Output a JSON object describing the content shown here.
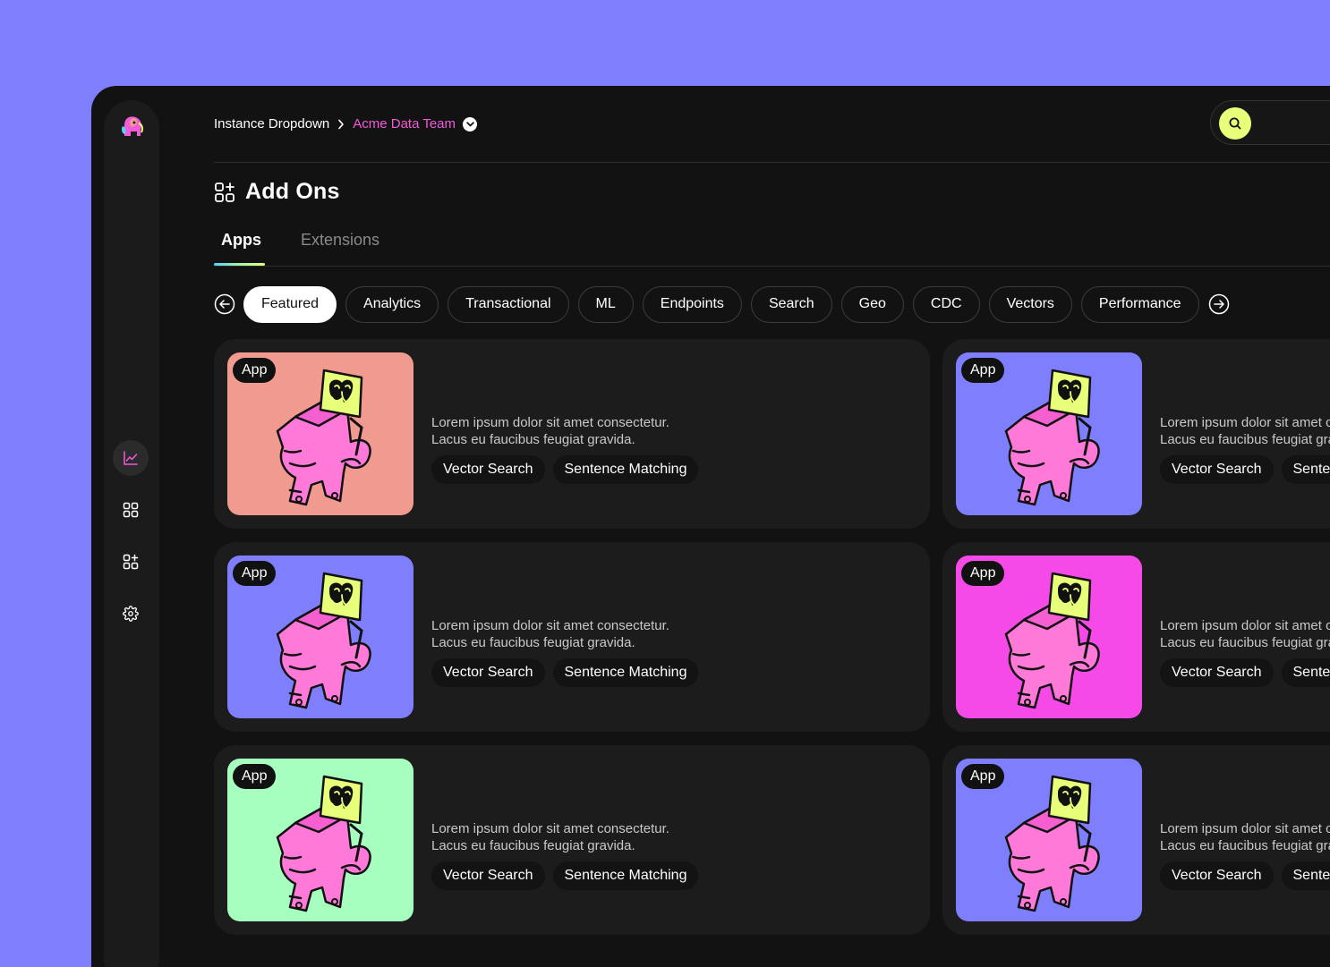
{
  "breadcrumb": {
    "instance": "Instance Dropdown",
    "team": "Acme Data Team"
  },
  "search": {
    "icon": "search-icon"
  },
  "page": {
    "title": "Add Ons"
  },
  "tabs": [
    {
      "label": "Apps",
      "active": true
    },
    {
      "label": "Extensions",
      "active": false
    }
  ],
  "filters": [
    "Featured",
    "Analytics",
    "Transactional",
    "ML",
    "Endpoints",
    "Search",
    "Geo",
    "CDC",
    "Vectors",
    "Performance"
  ],
  "sidebar": {
    "items": [
      {
        "icon": "line-chart-icon",
        "active": true
      },
      {
        "icon": "grid-icon",
        "active": false
      },
      {
        "icon": "add-ons-icon",
        "active": false
      },
      {
        "icon": "settings-gear-icon",
        "active": false
      }
    ]
  },
  "cards": [
    {
      "badge": "App",
      "bg": "#f19a90",
      "desc1": "Lorem ipsum dolor sit amet consectetur.",
      "desc2": "Lacus eu faucibus feugiat gravida.",
      "tags": [
        "Vector Search",
        "Sentence Matching"
      ]
    },
    {
      "badge": "App",
      "bg": "#7f7ffe",
      "desc1": "Lorem ipsum dolor sit amet consectetur.",
      "desc2": "Lacus eu faucibus feugiat gravida.",
      "tags": [
        "Vector Search",
        "Sentence Matching"
      ]
    },
    {
      "badge": "App",
      "bg": "#7f7ffe",
      "desc1": "Lorem ipsum dolor sit amet consectetur.",
      "desc2": "Lacus eu faucibus feugiat gravida.",
      "tags": [
        "Vector Search",
        "Sentence Matching"
      ]
    },
    {
      "badge": "App",
      "bg": "#f54ae8",
      "desc1": "Lorem ipsum dolor sit amet consectetur.",
      "desc2": "Lacus eu faucibus feugiat gravida.",
      "tags": [
        "Vector Search",
        "Sentence Matching"
      ]
    },
    {
      "badge": "App",
      "bg": "#a6ffbe",
      "desc1": "Lorem ipsum dolor sit amet consectetur.",
      "desc2": "Lacus eu faucibus feugiat gravida.",
      "tags": [
        "Vector Search",
        "Sentence Matching"
      ]
    },
    {
      "badge": "App",
      "bg": "#7f7ffe",
      "desc1": "Lorem ipsum dolor sit amet consectetur.",
      "desc2": "Lacus eu faucibus feugiat gravida.",
      "tags": [
        "Vector Search",
        "Sentence Matching"
      ]
    }
  ],
  "colors": {
    "accent": "#f35bd8",
    "search": "#e8ff7a",
    "background": "#7f7ffe",
    "window": "#121212"
  }
}
